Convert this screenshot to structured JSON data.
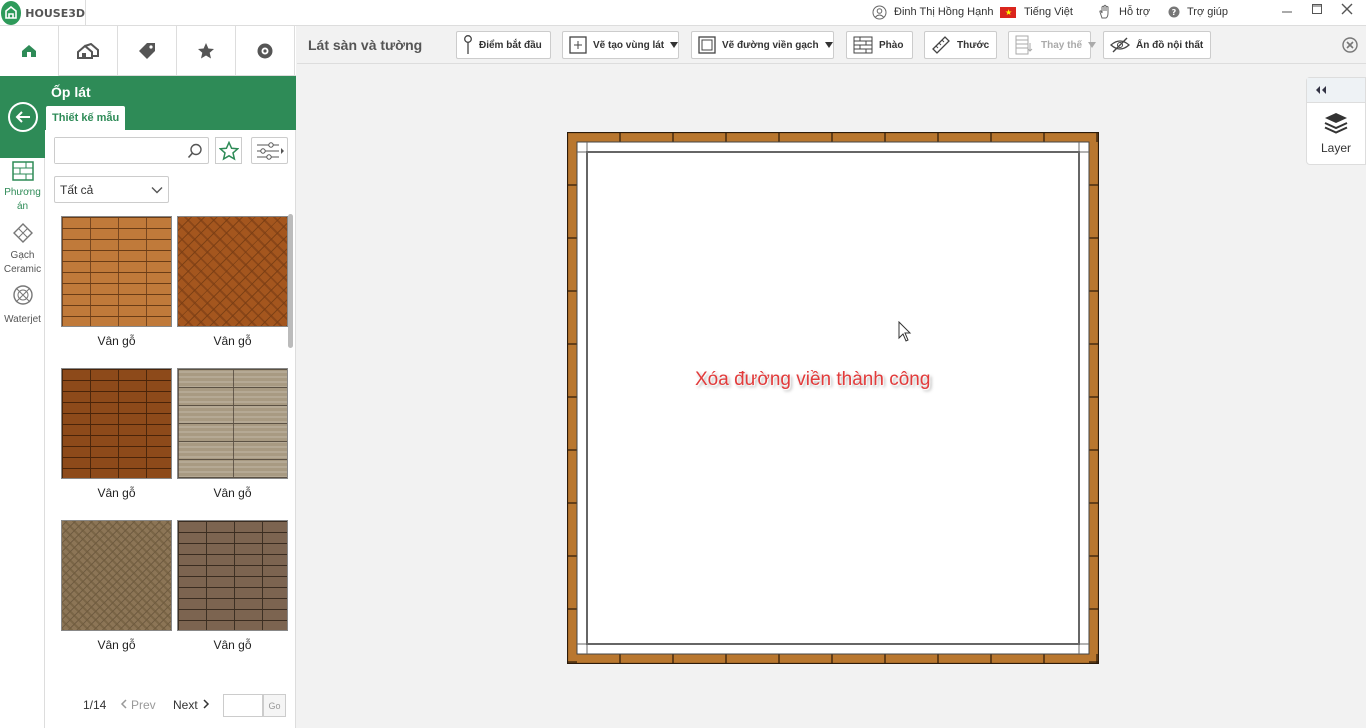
{
  "titlebar": {
    "app_name": "HOUSE3D",
    "user": "Đinh Thị Hồng Hạnh",
    "language": "Tiếng Việt",
    "support": "Hỗ trợ",
    "help": "Trợ giúp"
  },
  "panel": {
    "title": "Ốp lát",
    "subtab": "Thiết kế mẫu",
    "search_placeholder": "",
    "filter_value": "Tất cả",
    "rail": [
      {
        "label": "Phương án",
        "icon": "grid-icon"
      },
      {
        "label": "Gạch Ceramic",
        "icon": "tile-icon"
      },
      {
        "label": "Waterjet",
        "icon": "waterjet-icon"
      }
    ],
    "tiles": [
      {
        "label": "Vân gỗ"
      },
      {
        "label": "Vân gỗ"
      },
      {
        "label": "Vân gỗ"
      },
      {
        "label": "Vân gỗ"
      },
      {
        "label": "Vân gỗ"
      },
      {
        "label": "Vân gỗ"
      }
    ],
    "pager": {
      "page": "1/14",
      "prev": "Prev",
      "next": "Next",
      "go": "Go"
    }
  },
  "toolbar": {
    "title": "Lát sàn và tường",
    "buttons": [
      {
        "label": "Điểm bắt đầu"
      },
      {
        "label": "Vẽ tạo vùng lát"
      },
      {
        "label": "Vẽ đường viền gạch"
      },
      {
        "label": "Phào"
      },
      {
        "label": "Thước"
      },
      {
        "label": "Thay thế"
      },
      {
        "label": "Ẩn đồ nội thất"
      }
    ]
  },
  "layer": {
    "label": "Layer"
  },
  "canvas": {
    "message": "Xóa đường viền thành công"
  },
  "colors": {
    "brand_green": "#2e8b57",
    "message_red": "#e23b3b",
    "wood": "#b9772f"
  }
}
